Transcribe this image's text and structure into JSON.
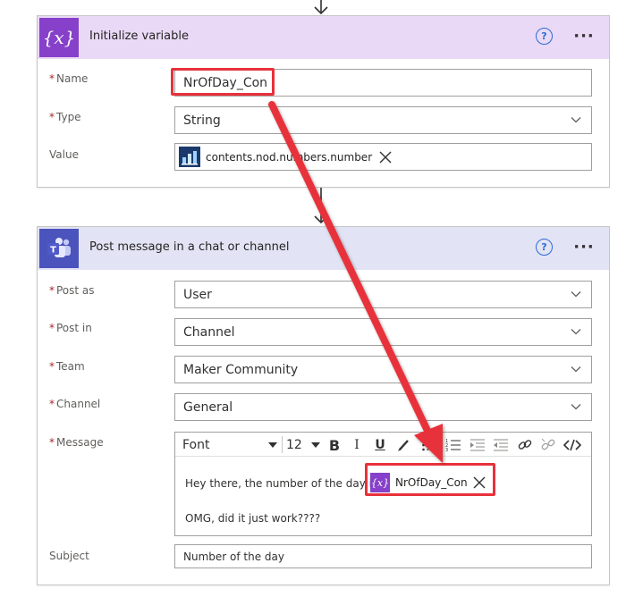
{
  "card1": {
    "title": "Initialize variable",
    "icon": "curly-braces-x-icon",
    "accent": "#8640c9",
    "header_bg": "#e9d9f6",
    "help": "?",
    "more": "···",
    "fields": {
      "name": {
        "label": "Name",
        "value": "NrOfDay_Con",
        "required": "*"
      },
      "type": {
        "label": "Type",
        "value": "String",
        "required": "*"
      },
      "value": {
        "label": "Value",
        "token": "contents.nod.numbers.number"
      }
    }
  },
  "card2": {
    "title": "Post message in a chat or channel",
    "icon": "teams-icon",
    "accent": "#4b53bc",
    "header_bg": "#e2e3f4",
    "help": "?",
    "more": "···",
    "fields": {
      "post_as": {
        "label": "Post as",
        "value": "User",
        "required": "*"
      },
      "post_in": {
        "label": "Post in",
        "value": "Channel",
        "required": "*"
      },
      "team": {
        "label": "Team",
        "value": "Maker Community",
        "required": "*"
      },
      "channel": {
        "label": "Channel",
        "value": "General",
        "required": "*"
      },
      "message": {
        "label": "Message",
        "required": "*",
        "toolbar": {
          "font": "Font",
          "size": "12",
          "bold": "B",
          "italic": "I",
          "underline": "U"
        },
        "line1": "Hey there, the number of the day is",
        "token": "NrOfDay_Con",
        "line2": "OMG, did it just work????"
      },
      "subject": {
        "label": "Subject",
        "value": "Number of the day"
      }
    }
  },
  "colors": {
    "annotation_red": "#e8313b"
  }
}
